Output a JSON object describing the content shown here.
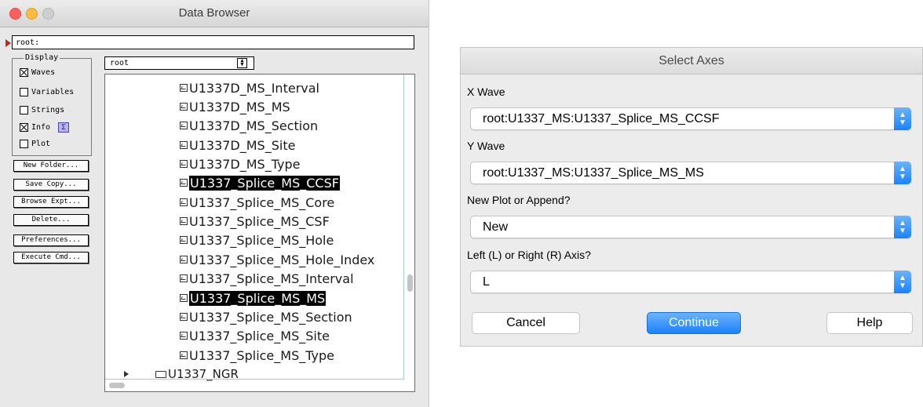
{
  "data_browser": {
    "title": "Data Browser",
    "path_value": "root:",
    "display_legend": "Display",
    "display_options": [
      {
        "label": "Waves",
        "checked": true
      },
      {
        "label": "Variables",
        "checked": false
      },
      {
        "label": "Strings",
        "checked": false
      },
      {
        "label": "Info",
        "checked": true
      },
      {
        "label": "Plot",
        "checked": false
      }
    ],
    "sigma_symbol": "Σ",
    "buttons": [
      "New Folder...",
      "Save Copy...",
      "Browse Expt...",
      "Delete...",
      "Preferences...",
      "Execute Cmd..."
    ],
    "folder_select": "root",
    "waves": [
      {
        "name": "U1337D_MS_Interval",
        "selected": false
      },
      {
        "name": "U1337D_MS_MS",
        "selected": false
      },
      {
        "name": "U1337D_MS_Section",
        "selected": false
      },
      {
        "name": "U1337D_MS_Site",
        "selected": false
      },
      {
        "name": "U1337D_MS_Type",
        "selected": false
      },
      {
        "name": "U1337_Splice_MS_CCSF",
        "selected": true
      },
      {
        "name": "U1337_Splice_MS_Core",
        "selected": false
      },
      {
        "name": "U1337_Splice_MS_CSF",
        "selected": false
      },
      {
        "name": "U1337_Splice_MS_Hole",
        "selected": false
      },
      {
        "name": "U1337_Splice_MS_Hole_Index",
        "selected": false
      },
      {
        "name": "U1337_Splice_MS_Interval",
        "selected": false
      },
      {
        "name": "U1337_Splice_MS_MS",
        "selected": true
      },
      {
        "name": "U1337_Splice_MS_Section",
        "selected": false
      },
      {
        "name": "U1337_Splice_MS_Site",
        "selected": false
      },
      {
        "name": "U1337_Splice_MS_Type",
        "selected": false
      }
    ],
    "folder_partial": "U1337_NGR"
  },
  "select_axes": {
    "title": "Select Axes",
    "x_wave_label": "X Wave",
    "x_wave_value": "root:U1337_MS:U1337_Splice_MS_CCSF",
    "y_wave_label": "Y Wave",
    "y_wave_value": "root:U1337_MS:U1337_Splice_MS_MS",
    "plot_mode_label": "New Plot or Append?",
    "plot_mode_value": "New",
    "axis_label": "Left (L) or Right (R) Axis?",
    "axis_value": "L",
    "cancel_label": "Cancel",
    "continue_label": "Continue",
    "help_label": "Help"
  }
}
